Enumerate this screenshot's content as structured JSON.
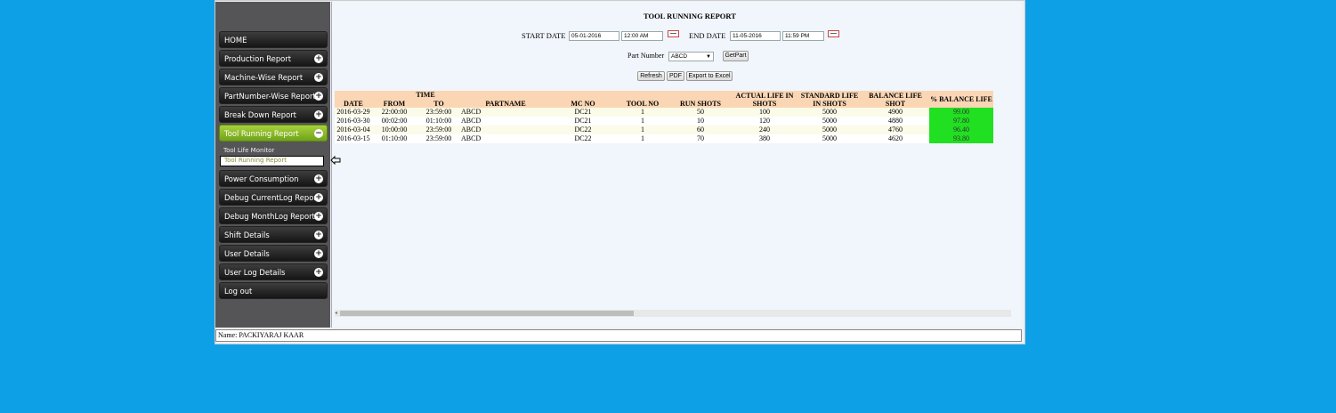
{
  "page": {
    "title": "TOOL RUNNING REPORT",
    "start_date_label": "START DATE",
    "start_date": "05-01-2016",
    "start_time": "12:00 AM",
    "end_date_label": "END DATE",
    "end_date": "11-05-2016",
    "end_time": "11:59 PM",
    "part_number_label": "Part Number",
    "part_number_value": "ABCD",
    "getpart_label": "GetPart",
    "refresh_label": "Refresh",
    "pdf_label": "PDF",
    "export_label": "Export to Excel"
  },
  "menu": {
    "home": "HOME",
    "production": "Production Report",
    "machine": "Machine-Wise Report",
    "partnumber": "PartNumber-Wise Report",
    "breakdown": "Break Down Report",
    "toolrunning": "Tool Running Report",
    "sub_toollife": "Tool Life Monitor",
    "sub_toolrunning": "Tool Running Report",
    "power": "Power Consumption",
    "debug_current": "Debug CurrentLog Report",
    "debug_month": "Debug MonthLog Report",
    "shift": "Shift Details",
    "user": "User Details",
    "userlog": "User Log Details",
    "logout": "Log out",
    "plus_glyph": "+",
    "minus_glyph": "−"
  },
  "table": {
    "h_date": "DATE",
    "h_time": "TIME",
    "h_from": "FROM",
    "h_to": "TO",
    "h_partname": "PARTNAME",
    "h_mcno": "MC NO",
    "h_toolno": "TOOL NO",
    "h_runshots": "RUN SHOTS",
    "h_actual": "ACTUAL LIFE IN SHOTS",
    "h_standard": "STANDARD LIFE IN SHOTS",
    "h_balance": "BALANCE LIFE SHOT",
    "h_pct": "% BALANCE LIFE",
    "rows": [
      {
        "date": "2016-03-29",
        "from": "22:00:00",
        "to": "23:59:00",
        "part": "ABCD",
        "mc": "DC21",
        "tool": "1",
        "run": "50",
        "actual": "100",
        "standard": "5000",
        "balance": "4900",
        "pct": "99.00"
      },
      {
        "date": "2016-03-30",
        "from": "00:02:00",
        "to": "01:10:00",
        "part": "ABCD",
        "mc": "DC21",
        "tool": "1",
        "run": "10",
        "actual": "120",
        "standard": "5000",
        "balance": "4880",
        "pct": "97.80"
      },
      {
        "date": "2016-03-04",
        "from": "10:00:00",
        "to": "23:59:00",
        "part": "ABCD",
        "mc": "DC22",
        "tool": "1",
        "run": "60",
        "actual": "240",
        "standard": "5000",
        "balance": "4760",
        "pct": "96.40"
      },
      {
        "date": "2016-03-15",
        "from": "01:10:00",
        "to": "23:59:00",
        "part": "ABCD",
        "mc": "DC22",
        "tool": "1",
        "run": "70",
        "actual": "380",
        "standard": "5000",
        "balance": "4620",
        "pct": "93.80"
      }
    ]
  },
  "footer": {
    "name": "Name: PACKIYARAJ KAAR"
  },
  "colors": {
    "background": "#0ea0e6",
    "balance_cell": "#21e021",
    "header_row": "#fad6b4",
    "active_menu": "#8dbd2a"
  }
}
